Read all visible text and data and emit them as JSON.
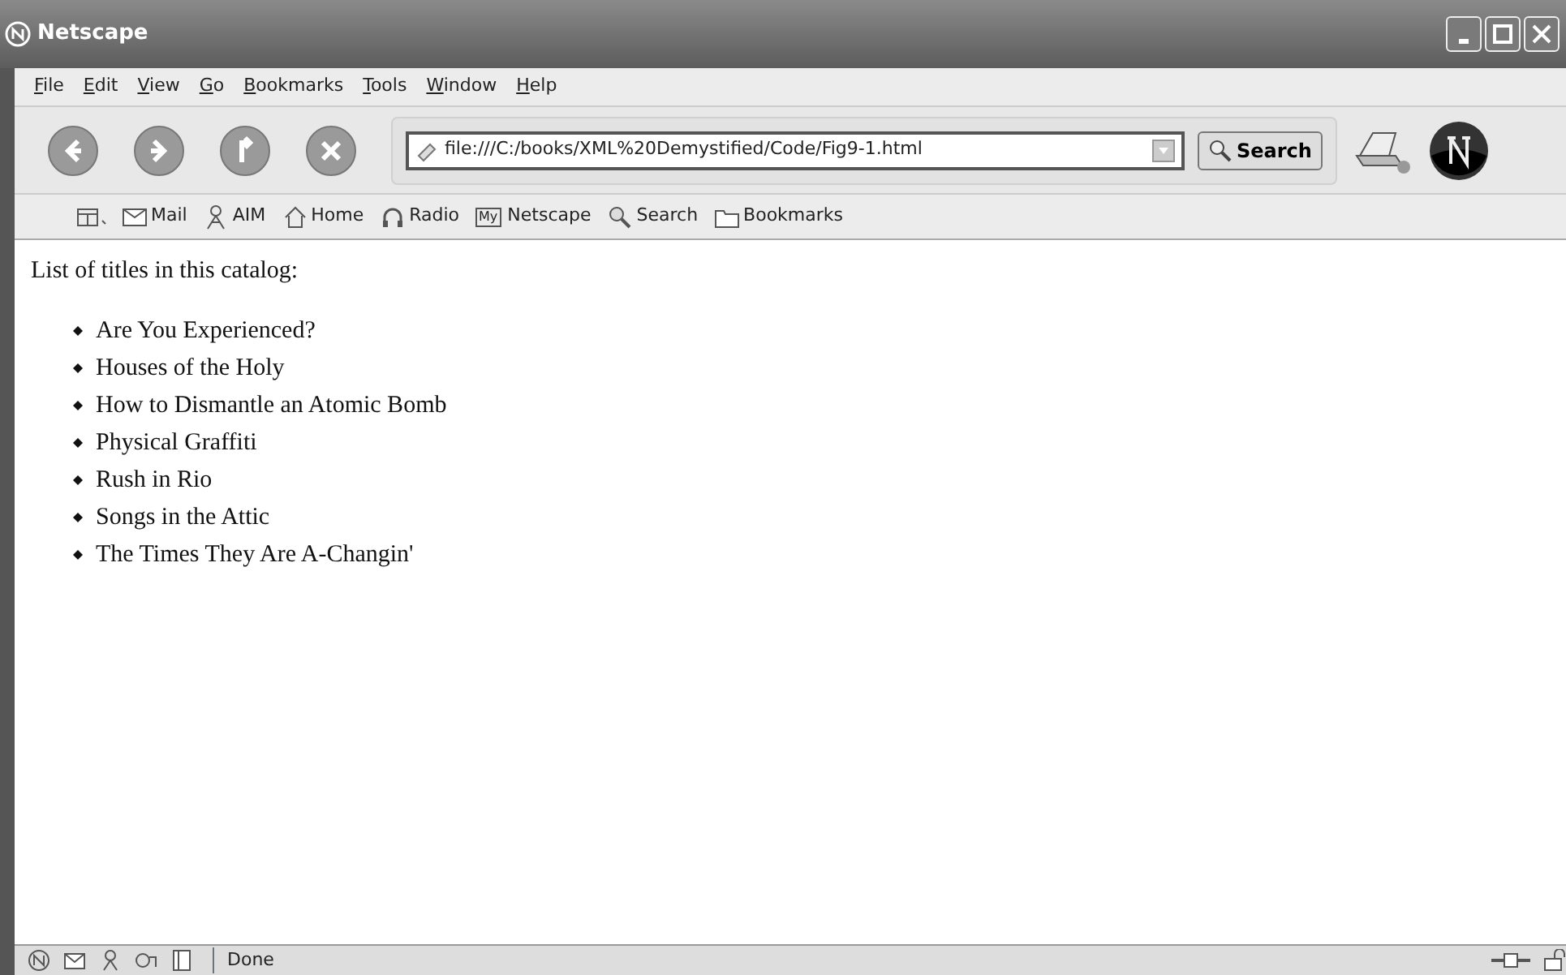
{
  "window": {
    "title": "Netscape"
  },
  "menu": [
    "File",
    "Edit",
    "View",
    "Go",
    "Bookmarks",
    "Tools",
    "Window",
    "Help"
  ],
  "address": {
    "value": "file:///C:/books/XML%20Demystified/Code/Fig9-1.html"
  },
  "search_button": {
    "label": "Search"
  },
  "personal_toolbar": [
    {
      "kind": "mail",
      "label": "Mail"
    },
    {
      "kind": "aim",
      "label": "AIM"
    },
    {
      "kind": "home",
      "label": "Home"
    },
    {
      "kind": "radio",
      "label": "Radio"
    },
    {
      "kind": "my",
      "label": "Netscape",
      "icon_text": "My"
    },
    {
      "kind": "search",
      "label": "Search"
    },
    {
      "kind": "folder",
      "label": "Bookmarks"
    }
  ],
  "page": {
    "heading": "List of titles in this catalog:",
    "items": [
      "Are You Experienced?",
      "Houses of the Holy",
      "How to Dismantle an Atomic Bomb",
      "Physical Graffiti",
      "Rush in Rio",
      "Songs in the Attic",
      "The Times They Are A-Changin'"
    ]
  },
  "status_bar": {
    "text": "Done"
  }
}
